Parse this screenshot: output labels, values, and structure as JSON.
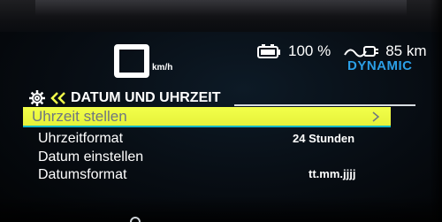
{
  "speed_display": {
    "unit": "km/h"
  },
  "status_bar": {
    "battery_icon": "battery-icon",
    "battery_text": "100 %",
    "range_icon": "range-plug-icon",
    "range_text": "85 km",
    "drive_mode": "DYNAMIC",
    "drive_mode_color": "#2b9fe6"
  },
  "menu": {
    "header_icon": "gear-icon",
    "back_icon": "double-chevron-left-icon",
    "title": "DATUM UND UHRZEIT",
    "selected_index": 0,
    "highlight_color": "#f2ff4a",
    "items": [
      {
        "label": "Uhrzeit stellen",
        "value": ""
      },
      {
        "label": "Uhrzeitformat",
        "value": "24 Stunden"
      },
      {
        "label": "Datum einstellen",
        "value": ""
      },
      {
        "label": "Datumsformat",
        "value": "tt.mm.jjjj"
      }
    ]
  }
}
